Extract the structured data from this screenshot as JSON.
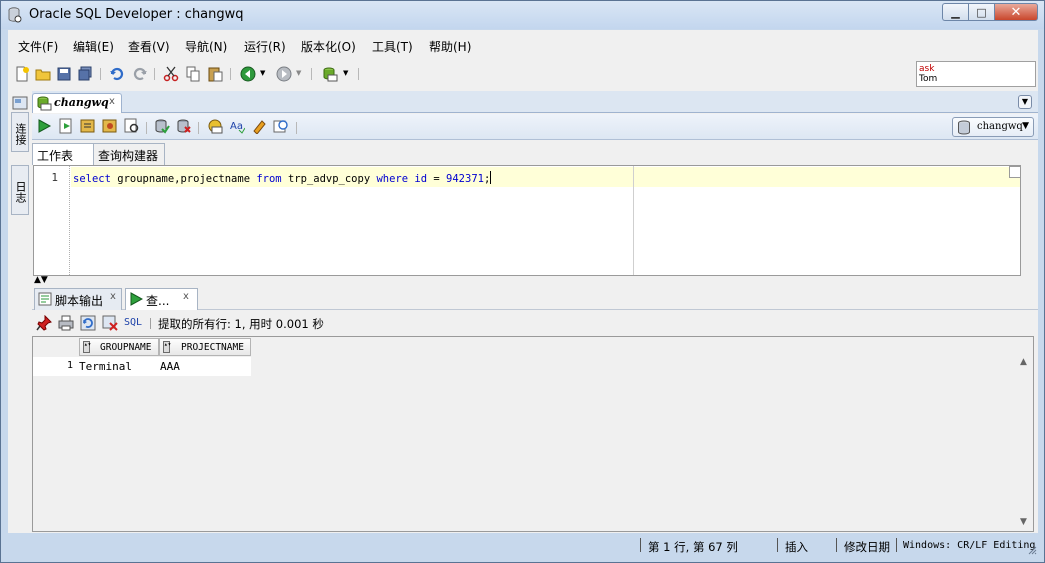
{
  "window": {
    "title": "Oracle SQL Developer : changwq",
    "controls": {
      "minimize": "▁",
      "maximize": "□",
      "close": "✕"
    }
  },
  "menu": {
    "items": [
      {
        "label": "文件(F)"
      },
      {
        "label": "编辑(E)"
      },
      {
        "label": "查看(V)"
      },
      {
        "label": "导航(N)"
      },
      {
        "label": "运行(R)"
      },
      {
        "label": "版本化(O)"
      },
      {
        "label": "工具(T)"
      },
      {
        "label": "帮助(H)"
      }
    ]
  },
  "toolbar": {
    "icons": [
      "new-icon",
      "open-icon",
      "save-icon",
      "save-all-icon",
      "undo-icon",
      "redo-icon",
      "cut-icon",
      "copy-icon",
      "paste-icon",
      "back-icon",
      "forward-icon",
      "sql-worksheet-icon"
    ]
  },
  "ask": {
    "line1": "ask",
    "line2": "Tom"
  },
  "left_panel": {
    "connections_label": "连接",
    "reports_label": "日志"
  },
  "document_tab": {
    "label": "changwq",
    "close": "x"
  },
  "connection_selector": {
    "value": "changwq"
  },
  "worksheet_tabs": [
    {
      "label": "工作表",
      "active": true
    },
    {
      "label": "查询构建器",
      "active": false
    }
  ],
  "editor": {
    "line_number": "1",
    "tokens": [
      {
        "text": "select",
        "kind": "kw"
      },
      {
        "text": " groupname,projectname ",
        "kind": "plain"
      },
      {
        "text": "from",
        "kind": "kw"
      },
      {
        "text": " trp_advp_copy ",
        "kind": "plain"
      },
      {
        "text": "where",
        "kind": "kw"
      },
      {
        "text": " ",
        "kind": "plain"
      },
      {
        "text": "id",
        "kind": "kw"
      },
      {
        "text": " = ",
        "kind": "plain"
      },
      {
        "text": "942371",
        "kind": "num"
      },
      {
        "text": ";",
        "kind": "plain"
      }
    ]
  },
  "output_tabs": [
    {
      "label": "脚本输出",
      "close": "x"
    },
    {
      "label": "查...",
      "close": "x"
    }
  ],
  "result_toolbar": {
    "sql_link": "SQL",
    "fetch_status": "提取的所有行: 1, 用时 0.001 秒"
  },
  "results": {
    "columns": [
      "GROUPNAME",
      "PROJECTNAME"
    ],
    "rows": [
      {
        "row_number": "1",
        "cells": [
          "Terminal",
          "AAA"
        ]
      }
    ]
  },
  "status_bar": {
    "position": "第 1 行, 第 67 列",
    "mode": "插入",
    "modified": "修改日期",
    "encoding": "Windows: CR/LF Editing"
  },
  "colors": {
    "keyword": "#0000d0",
    "current_line": "#ffffd8",
    "chrome": "#c7d8ec"
  }
}
